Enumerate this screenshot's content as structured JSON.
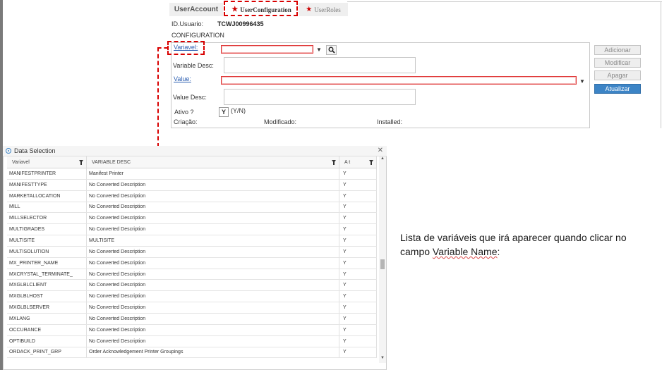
{
  "tabs": [
    {
      "label": "UserAccount"
    },
    {
      "label": "UserConfiguration"
    },
    {
      "label": "UserRoles"
    }
  ],
  "user": {
    "id_label": "ID.Usuario:",
    "id_value": "TCWJ00996435"
  },
  "section_title": "CONFIGURATION",
  "form": {
    "variavel_label": "Variavel:",
    "variable_desc_label": "Variable Desc:",
    "value_label": "Value:",
    "value_desc_label": "Value Desc:",
    "ativo_label": "Ativo ?",
    "ativo_value": "Y",
    "ativo_hint": "(Y/N)",
    "criacao_label": "Criação:",
    "modificado_label": "Modificado:",
    "installed_label": "Installed:"
  },
  "buttons": {
    "adicionar": "Adicionar",
    "modificar": "Modificar",
    "apagar": "Apagar",
    "atualizar": "Atualizar"
  },
  "panel": {
    "title": "Data Selection",
    "columns": [
      "Variavel",
      "VARIABLE DESC",
      "A t"
    ],
    "rows": [
      [
        "MANIFESTPRINTER",
        "Manifest Printer",
        "Y"
      ],
      [
        "MANIFESTTYPE",
        "No Converted Description",
        "Y"
      ],
      [
        "MARKETALLOCATION",
        "No Converted Description",
        "Y"
      ],
      [
        "MILL",
        "No Converted Description",
        "Y"
      ],
      [
        "MILLSELECTOR",
        "No Converted Description",
        "Y"
      ],
      [
        "MULTIGRADES",
        "No Converted Description",
        "Y"
      ],
      [
        "MULTISITE",
        "MULTISITE",
        "Y"
      ],
      [
        "MULTISOLUTION",
        "No Converted Description",
        "Y"
      ],
      [
        "MX_PRINTER_NAME",
        "No Converted Description",
        "Y"
      ],
      [
        "MXCRYSTAL_TERMINATE_",
        "No Converted Description",
        "Y"
      ],
      [
        "MXGLBLCLIENT",
        "No Converted Description",
        "Y"
      ],
      [
        "MXGLBLHOST",
        "No Converted Description",
        "Y"
      ],
      [
        "MXGLBLSERVER",
        "No Converted Description",
        "Y"
      ],
      [
        "MXLANG",
        "No Converted Description",
        "Y"
      ],
      [
        "OCCURANCE",
        "No Converted Description",
        "Y"
      ],
      [
        "OPTIBUILD",
        "No Converted Description",
        "Y"
      ],
      [
        "ORDACK_PRINT_GRP",
        "Order Acknowledgement Printer Groupings",
        "Y"
      ]
    ]
  },
  "note": {
    "text_before": "Lista de variáveis que irá aparecer quando clicar no campo ",
    "text_highlight": "Variable Name",
    "text_after": ":"
  },
  "colors": {
    "highlight": "#d80000",
    "primary_button": "#3c84c6",
    "link": "#2a5db0"
  }
}
